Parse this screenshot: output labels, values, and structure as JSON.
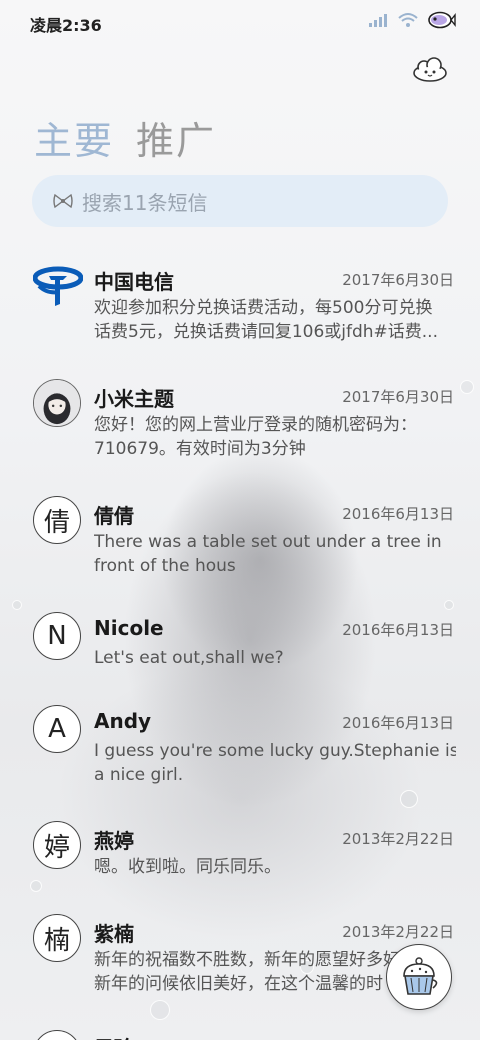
{
  "status_bar": {
    "time": "凌晨2:36"
  },
  "tabs": [
    {
      "label": "主要"
    },
    {
      "label": "推广"
    }
  ],
  "search": {
    "placeholder": "搜索11条短信"
  },
  "messages": [
    {
      "name": "中国电信",
      "date": "2017年6月30日",
      "line1": "欢迎参加积分兑换话费活动，每500分可兑换",
      "line2": "话费5元，兑换话费请回复106或jfdh#话费..."
    },
    {
      "name": "小米主题",
      "date": "2017年6月30日",
      "line1": "您好！您的网上营业厅登录的随机密码为：",
      "line2": "710679。有效时间为3分钟"
    },
    {
      "name": "倩倩",
      "avatar": "倩",
      "date": "2016年6月13日",
      "line1": "There was a table set out under a tree in",
      "line2": "front of the hous"
    },
    {
      "name": "Nicole",
      "avatar": "N",
      "date": "2016年6月13日",
      "line1": "Let's eat out,shall we?"
    },
    {
      "name": "Andy",
      "avatar": "A",
      "date": "2016年6月13日",
      "line1": "I guess you're some lucky guy.Stephanie is",
      "line2": "a nice girl."
    },
    {
      "name": "燕婷",
      "avatar": "婷",
      "date": "2013年2月22日",
      "line1": "嗯。收到啦。同乐同乐。"
    },
    {
      "name": "紫楠",
      "avatar": "楠",
      "date": "2013年2月22日",
      "line1": "新年的祝福数不胜数，新年的愿望好多好",
      "line2": "新年的问候依旧美好，在这个温馨的时"
    },
    {
      "name": "子玲"
    }
  ],
  "colors": {
    "active_tab": "#9fb7d3",
    "inactive_tab": "#9a9a9a",
    "search_bg": "#e2ecf7",
    "telecom_blue": "#0a5cb8"
  },
  "icons": [
    "signal-icon",
    "wifi-icon",
    "battery-fish-icon",
    "cloud-sync-icon",
    "search-bow-icon",
    "china-telecom-logo",
    "cupcake-compose-icon"
  ]
}
